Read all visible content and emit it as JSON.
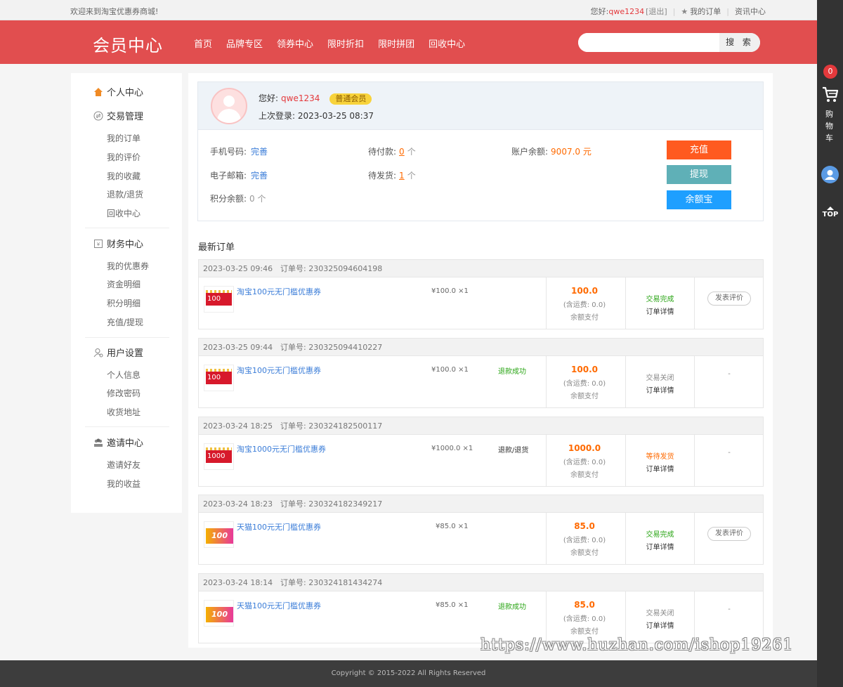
{
  "topbar": {
    "welcome": "欢迎来到淘宝优惠券商城!",
    "hello_label": "您好:",
    "username": "qwe1234",
    "logout": "[退出]",
    "my_orders": "我的订单",
    "news": "资讯中心"
  },
  "header": {
    "logo": "会员中心",
    "nav": [
      "首页",
      "品牌专区",
      "领券中心",
      "限时折扣",
      "限时拼团",
      "回收中心"
    ],
    "search_placeholder": "",
    "search_button": "搜 索"
  },
  "rightbar": {
    "cart_count": "0",
    "cart_label": [
      "购",
      "物",
      "车"
    ],
    "top_label": "TOP"
  },
  "leftmenu": {
    "personal": "个人中心",
    "trade": {
      "title": "交易管理",
      "items": [
        "我的订单",
        "我的评价",
        "我的收藏",
        "退款/退货",
        "回收中心"
      ]
    },
    "finance": {
      "title": "财务中心",
      "items": [
        "我的优惠券",
        "资金明细",
        "积分明细",
        "充值/提现"
      ]
    },
    "user": {
      "title": "用户设置",
      "items": [
        "个人信息",
        "修改密码",
        "收货地址"
      ]
    },
    "invite": {
      "title": "邀请中心",
      "items": [
        "邀请好友",
        "我的收益"
      ]
    }
  },
  "profile": {
    "hello": "您好:",
    "username": "qwe1234",
    "level": "普通会员",
    "last_login": "上次登录: 2023-03-25 08:37",
    "phone_label": "手机号码:",
    "phone_value": "完善",
    "email_label": "电子邮箱:",
    "email_value": "完善",
    "points_label": "积分余额:",
    "points_value": "0 个",
    "unpaid_label": "待付款:",
    "unpaid_value": "0",
    "unpaid_unit": "个",
    "unshipped_label": "待发货:",
    "unshipped_value": "1",
    "unshipped_unit": "个",
    "balance_label": "账户余额:",
    "balance_value": "9007.0 元",
    "recharge": "充值",
    "withdraw": "提现",
    "yuebao": "余额宝"
  },
  "orders_title": "最新订单",
  "order_labels": {
    "no_prefix": "订单号:",
    "shipping": "(含运费: 0.0)",
    "pay": "余额支付",
    "detail": "订单详情"
  },
  "orders": [
    {
      "time": "2023-03-25 09:46",
      "no": "230325094604198",
      "thumb": "100",
      "name": "淘宝100元无门槛优惠券",
      "price": "¥100.0 ×1",
      "refund": "",
      "amount": "100.0",
      "status": "交易完成",
      "op": "发表评价"
    },
    {
      "time": "2023-03-25 09:44",
      "no": "230325094410227",
      "thumb": "100",
      "name": "淘宝100元无门槛优惠券",
      "price": "¥100.0 ×1",
      "refund": "退款成功",
      "amount": "100.0",
      "status": "交易关闭",
      "op": "-"
    },
    {
      "time": "2023-03-24 18:25",
      "no": "230324182500117",
      "thumb": "1000",
      "name": "淘宝1000元无门槛优惠券",
      "price": "¥1000.0 ×1",
      "refund": "退款/退货",
      "amount": "1000.0",
      "status": "等待发货",
      "op": "-"
    },
    {
      "time": "2023-03-24 18:23",
      "no": "230324182349217",
      "thumb": "100",
      "name": "天猫100元无门槛优惠券",
      "price": "¥85.0 ×1",
      "refund": "",
      "amount": "85.0",
      "status": "交易完成",
      "op": "发表评价"
    },
    {
      "time": "2023-03-24 18:14",
      "no": "230324181434274",
      "thumb": "100",
      "name": "天猫100元无门槛优惠券",
      "price": "¥85.0 ×1",
      "refund": "退款成功",
      "amount": "85.0",
      "status": "交易关闭",
      "op": "-"
    }
  ],
  "footer": "Copyright © 2015-2022 All Rights Reserved",
  "watermark": "https://www.huzhan.com/ishop19261",
  "colors": {
    "brand": "#e14e4f",
    "orange": "#ff6a00",
    "link": "#3b7dd8",
    "green": "#2aa515"
  }
}
